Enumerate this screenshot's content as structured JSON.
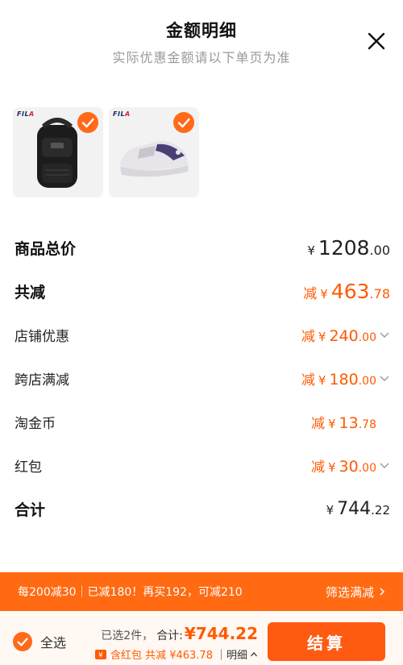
{
  "header": {
    "title": "金额明细",
    "subtitle": "实际优惠金额请以下单页为准"
  },
  "products": [
    {
      "brand_main": "FIL",
      "brand_accent": "A",
      "item": "black backpack",
      "selected": true
    },
    {
      "brand_main": "FIL",
      "brand_accent": "A",
      "item": "white sneaker",
      "selected": true
    }
  ],
  "breakdown": {
    "goods_total": {
      "label": "商品总价",
      "yen": "¥",
      "int": "1208",
      "dec": ".00"
    },
    "total_discount": {
      "label": "共减",
      "prefix": "减",
      "yen": "¥",
      "int": "463",
      "dec": ".78"
    },
    "shop_discount": {
      "label": "店铺优惠",
      "prefix": "减",
      "yen": "¥",
      "int": "240",
      "dec": ".00"
    },
    "cross_shop": {
      "label": "跨店满减",
      "prefix": "减",
      "yen": "¥",
      "int": "180",
      "dec": ".00"
    },
    "taojinbi": {
      "label": "淘金币",
      "prefix": "减",
      "yen": "¥",
      "int": "13",
      "dec": ".78"
    },
    "red_packet": {
      "label": "红包",
      "prefix": "减",
      "yen": "¥",
      "int": "30",
      "dec": ".00"
    },
    "subtotal": {
      "label": "合计",
      "yen": "¥",
      "int": "744",
      "dec": ".22"
    }
  },
  "promo": {
    "text": "每200减30｜已减180！再买192，可减210",
    "filter_label": "筛选满减"
  },
  "footer": {
    "select_all": "全选",
    "selected_count": "已选2件，",
    "total_label": "合计:",
    "total_value": "¥744.22",
    "discount_text": "含红包 共减 ¥463.78",
    "detail_label": "｜明细",
    "checkout_label": "结算"
  },
  "colors": {
    "accent": "#ff5a00",
    "promo_bg": "#ff6a12",
    "check": "#ff6a1a"
  }
}
